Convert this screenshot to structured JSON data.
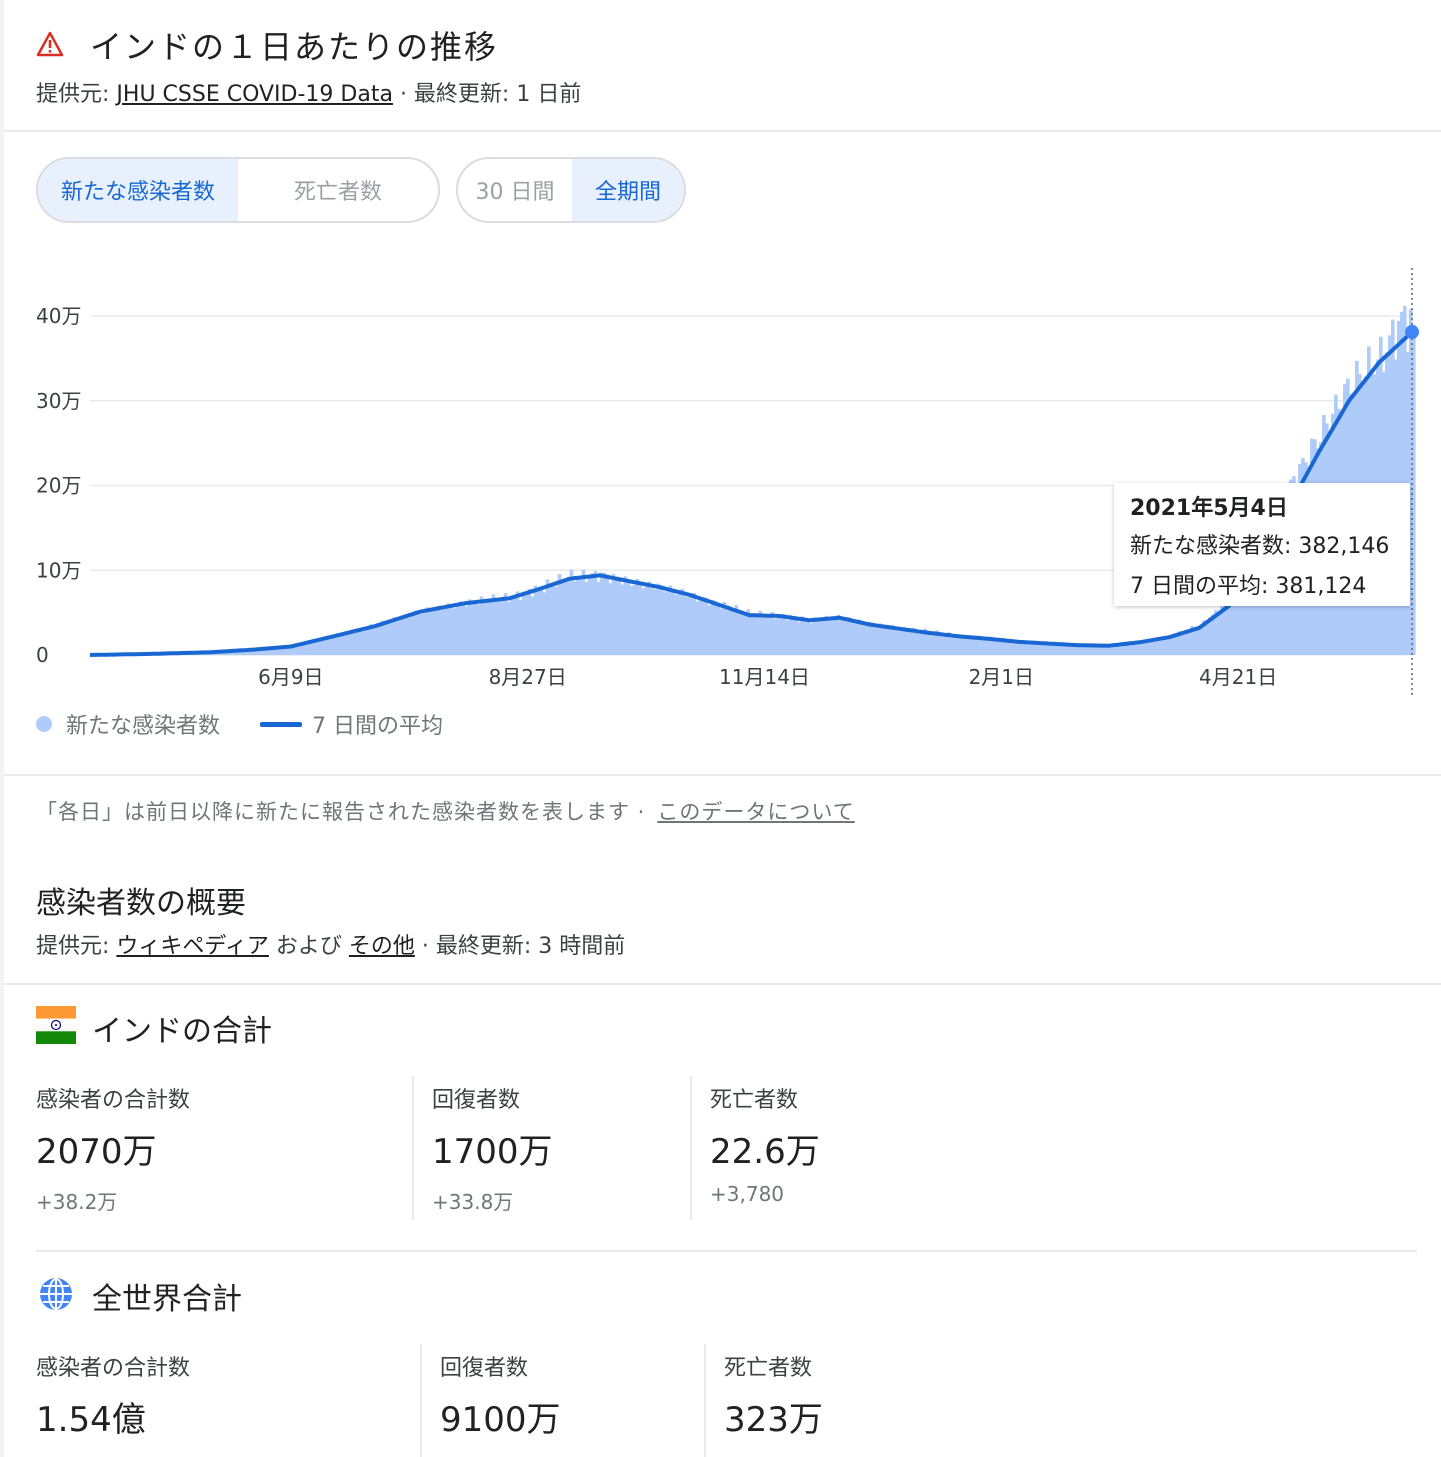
{
  "header": {
    "title": "インドの１日あたりの推移",
    "source_prefix": "提供元: ",
    "source_link": "JHU CSSE COVID-19 Data",
    "updated": " · 最終更新: 1 日前"
  },
  "toggles": {
    "metric": [
      "新たな感染者数",
      "死亡者数"
    ],
    "range": [
      "30 日間",
      "全期間"
    ]
  },
  "colors": {
    "bar": "#aecbfa",
    "line": "#1967d2",
    "accent": "#1967d2",
    "warning": "#d93025"
  },
  "chart_data": {
    "type": "bar",
    "title": "インドの１日あたりの推移",
    "y_ticks": [
      "0",
      "10万",
      "20万",
      "30万",
      "40万"
    ],
    "ylim": [
      0,
      400000
    ],
    "x_ticks": [
      "6月9日",
      "8月27日",
      "11月14日",
      "2月1日",
      "4月21日"
    ],
    "x_tick_positions": [
      67,
      146,
      225,
      304,
      383
    ],
    "grid": true,
    "legend_position": "bottom-left",
    "series": [
      {
        "name": "新たな感染者数",
        "kind": "bar",
        "day_values": [
          [
            0,
            0
          ],
          [
            20,
            1500
          ],
          [
            40,
            3500
          ],
          [
            55,
            7000
          ],
          [
            67,
            11000
          ],
          [
            80,
            22000
          ],
          [
            95,
            35000
          ],
          [
            110,
            52000
          ],
          [
            125,
            62000
          ],
          [
            140,
            68000
          ],
          [
            150,
            80000
          ],
          [
            160,
            92000
          ],
          [
            170,
            95000
          ],
          [
            180,
            85000
          ],
          [
            190,
            80000
          ],
          [
            200,
            70000
          ],
          [
            210,
            60000
          ],
          [
            220,
            48000
          ],
          [
            230,
            47000
          ],
          [
            240,
            40000
          ],
          [
            250,
            45000
          ],
          [
            260,
            37000
          ],
          [
            270,
            32000
          ],
          [
            280,
            28000
          ],
          [
            290,
            23000
          ],
          [
            300,
            20000
          ],
          [
            310,
            16000
          ],
          [
            320,
            14000
          ],
          [
            330,
            12000
          ],
          [
            340,
            12000
          ],
          [
            350,
            16000
          ],
          [
            360,
            22000
          ],
          [
            370,
            35000
          ],
          [
            380,
            65000
          ],
          [
            390,
            120000
          ],
          [
            400,
            200000
          ],
          [
            410,
            260000
          ],
          [
            420,
            320000
          ],
          [
            430,
            350000
          ],
          [
            438,
            400000
          ],
          [
            441,
            382146
          ]
        ]
      },
      {
        "name": "7 日間の平均",
        "kind": "line",
        "day_values": [
          [
            0,
            0
          ],
          [
            20,
            1300
          ],
          [
            40,
            3200
          ],
          [
            55,
            6500
          ],
          [
            67,
            10000
          ],
          [
            80,
            21000
          ],
          [
            95,
            34000
          ],
          [
            110,
            51000
          ],
          [
            125,
            61000
          ],
          [
            140,
            67000
          ],
          [
            150,
            78000
          ],
          [
            160,
            90000
          ],
          [
            170,
            94000
          ],
          [
            180,
            87000
          ],
          [
            190,
            80000
          ],
          [
            200,
            71000
          ],
          [
            210,
            59000
          ],
          [
            220,
            47000
          ],
          [
            230,
            46000
          ],
          [
            240,
            41000
          ],
          [
            250,
            44000
          ],
          [
            260,
            36000
          ],
          [
            270,
            31000
          ],
          [
            280,
            26000
          ],
          [
            290,
            22000
          ],
          [
            300,
            19000
          ],
          [
            310,
            15500
          ],
          [
            320,
            13500
          ],
          [
            330,
            11500
          ],
          [
            340,
            11000
          ],
          [
            350,
            15000
          ],
          [
            360,
            21000
          ],
          [
            370,
            32000
          ],
          [
            380,
            58000
          ],
          [
            390,
            105000
          ],
          [
            400,
            175000
          ],
          [
            410,
            240000
          ],
          [
            420,
            300000
          ],
          [
            430,
            345000
          ],
          [
            441,
            381124
          ]
        ]
      }
    ]
  },
  "tooltip": {
    "date": "2021年5月4日",
    "cases_label": "新たな感染者数: 382,146",
    "avg_label": "7 日間の平均: 381,124"
  },
  "legend": {
    "bars": "新たな感染者数",
    "line": "7 日間の平均"
  },
  "note": {
    "text": "「各日」は前日以降に新たに報告された感染者数を表します ·",
    "link": "このデータについて"
  },
  "summary": {
    "title": "感染者数の概要",
    "source_prefix": "提供元: ",
    "source_link1": "ウィキペディア",
    "and": " および ",
    "source_link2": "その他",
    "updated": " · 最終更新: 3 時間前"
  },
  "india": {
    "title": "インドの合計",
    "stats": [
      {
        "label": "感染者の合計数",
        "value": "2070万",
        "delta": "+38.2万"
      },
      {
        "label": "回復者数",
        "value": "1700万",
        "delta": "+33.8万"
      },
      {
        "label": "死亡者数",
        "value": "22.6万",
        "delta": "+3,780"
      }
    ]
  },
  "world": {
    "title": "全世界合計",
    "stats": [
      {
        "label": "感染者の合計数",
        "value": "1.54億"
      },
      {
        "label": "回復者数",
        "value": "9100万"
      },
      {
        "label": "死亡者数",
        "value": "323万"
      }
    ]
  }
}
